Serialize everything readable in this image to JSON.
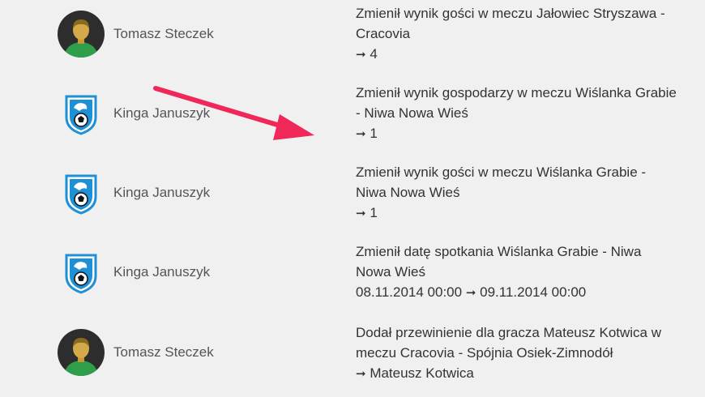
{
  "feed": {
    "items": [
      {
        "user": "Tomasz Steczek",
        "avatar": "user-avatar-icon",
        "desc": "Zmienił wynik gości w meczu Jałowiec Stryszawa - Cracovia",
        "value": "4"
      },
      {
        "user": "Kinga Januszyk",
        "avatar": "club-crest-icon",
        "desc": "Zmienił wynik gospodarzy w meczu Wiślanka Grabie - Niwa Nowa Wieś",
        "value": "1"
      },
      {
        "user": "Kinga Januszyk",
        "avatar": "club-crest-icon",
        "desc": "Zmienił wynik gości w meczu Wiślanka Grabie - Niwa Nowa Wieś",
        "value": "1"
      },
      {
        "user": "Kinga Januszyk",
        "avatar": "club-crest-icon",
        "desc": "Zmienił datę spotkania Wiślanka Grabie - Niwa Nowa Wieś",
        "old_value": "08.11.2014 00:00",
        "value": "09.11.2014 00:00"
      },
      {
        "user": "Tomasz Steczek",
        "avatar": "user-avatar-icon",
        "desc": "Dodał przewinienie dla gracza Mateusz Kotwica w meczu Cracovia - Spójnia Osiek-Zimnodół",
        "value": "Mateusz Kotwica"
      }
    ],
    "arrow_glyph": "➞"
  },
  "annotation": {
    "arrow_color": "#f0285a",
    "icon": "pointer-arrow-icon"
  },
  "colors": {
    "background": "#f0f0f0",
    "avatar_circle": "#2d2d2d",
    "avatar_skin": "#d4a94a",
    "avatar_shirt": "#2e9e4a",
    "crest_blue": "#1e90d6"
  }
}
